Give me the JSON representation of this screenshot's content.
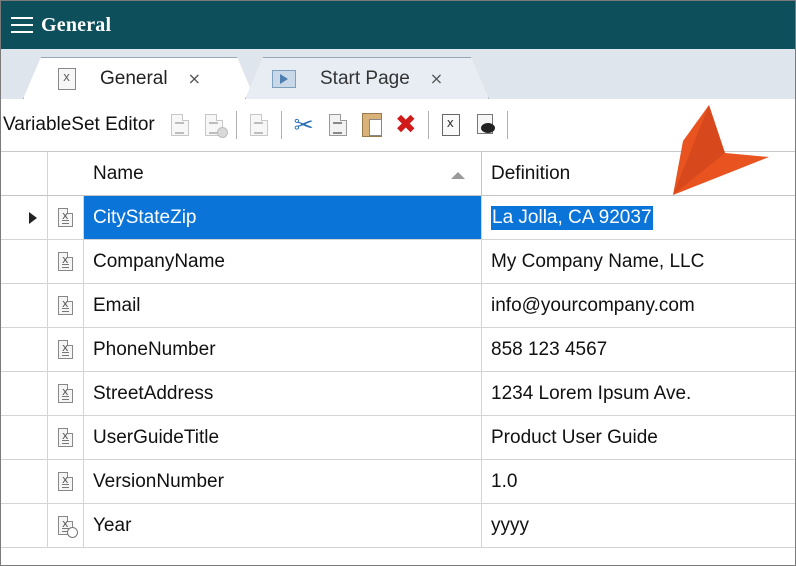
{
  "window": {
    "title": "General"
  },
  "tabs": [
    {
      "label": "General",
      "close": "×",
      "active": true
    },
    {
      "label": "Start Page",
      "close": "×",
      "active": false
    }
  ],
  "toolbar": {
    "title": "VariableSet Editor"
  },
  "grid": {
    "columns": {
      "name": "Name",
      "definition": "Definition"
    },
    "rows": [
      {
        "name": "CityStateZip",
        "definition": "La Jolla, CA 92037",
        "selected": true,
        "icon": "variable-icon"
      },
      {
        "name": "CompanyName",
        "definition": "My Company Name, LLC",
        "icon": "variable-icon"
      },
      {
        "name": "Email",
        "definition": "info@yourcompany.com",
        "icon": "variable-icon"
      },
      {
        "name": "PhoneNumber",
        "definition": "858 123 4567",
        "icon": "variable-icon"
      },
      {
        "name": "StreetAddress",
        "definition": "1234 Lorem Ipsum Ave.",
        "icon": "variable-icon"
      },
      {
        "name": "UserGuideTitle",
        "definition": "Product User Guide",
        "icon": "variable-icon"
      },
      {
        "name": "VersionNumber",
        "definition": "1.0",
        "icon": "variable-icon"
      },
      {
        "name": "Year",
        "definition": "yyyy",
        "icon": "datetime-variable-icon"
      }
    ]
  },
  "colors": {
    "titlebar": "#0e4f5c",
    "selection": "#0a74d9",
    "callout_arrow": "#e8531f",
    "delete_icon": "#d11a1a"
  }
}
